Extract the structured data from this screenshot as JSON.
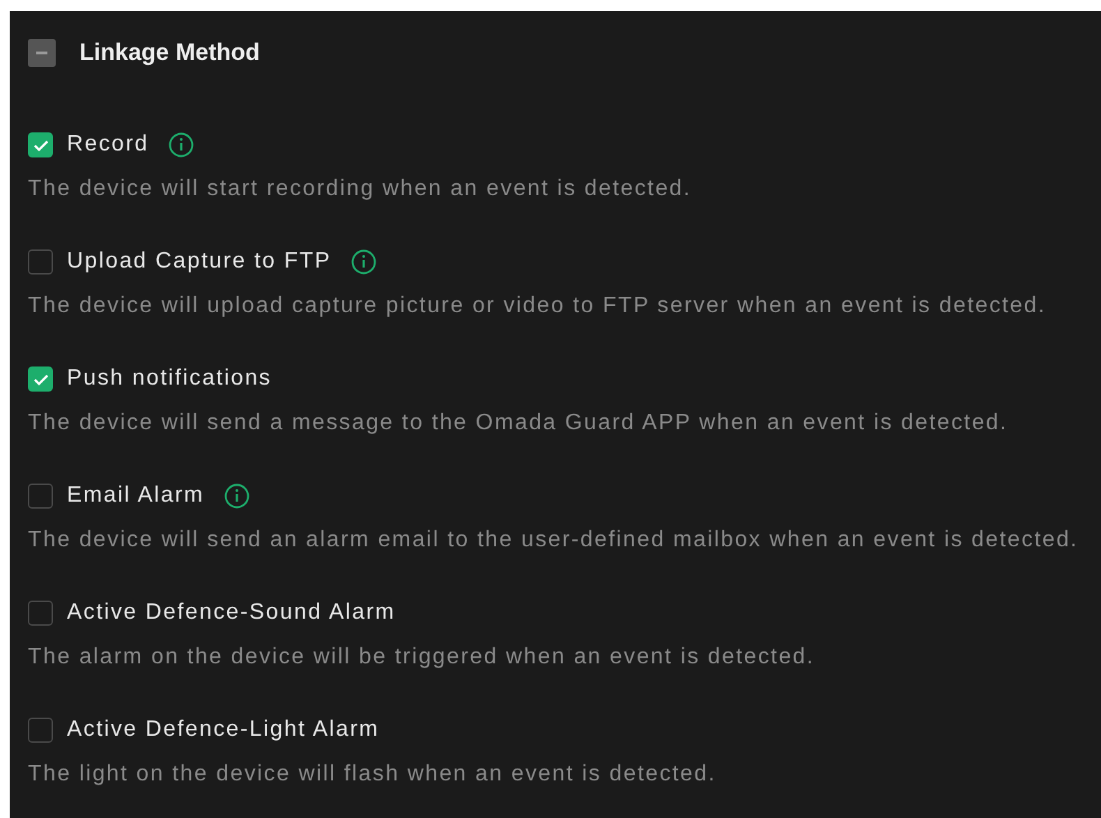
{
  "header": {
    "title": "Linkage Method",
    "indeterminate": true
  },
  "items": [
    {
      "label": "Record",
      "info": true,
      "checked": true,
      "description": "The device will start recording when an event is detected."
    },
    {
      "label": "Upload Capture to FTP",
      "info": true,
      "checked": false,
      "description": "The device will upload capture picture or video to FTP server when an event is detected."
    },
    {
      "label": "Push notifications",
      "info": false,
      "checked": true,
      "description": "The device will send a message to the Omada Guard APP when an event is detected."
    },
    {
      "label": "Email Alarm",
      "info": true,
      "checked": false,
      "description": "The device will send an alarm email to the user-defined mailbox when an event is detected."
    },
    {
      "label": "Active Defence-Sound Alarm",
      "info": false,
      "checked": false,
      "description": "The alarm on the device will be triggered when an event is detected."
    },
    {
      "label": "Active Defence-Light Alarm",
      "info": false,
      "checked": false,
      "description": "The light on the device will flash when an event is detected."
    }
  ]
}
